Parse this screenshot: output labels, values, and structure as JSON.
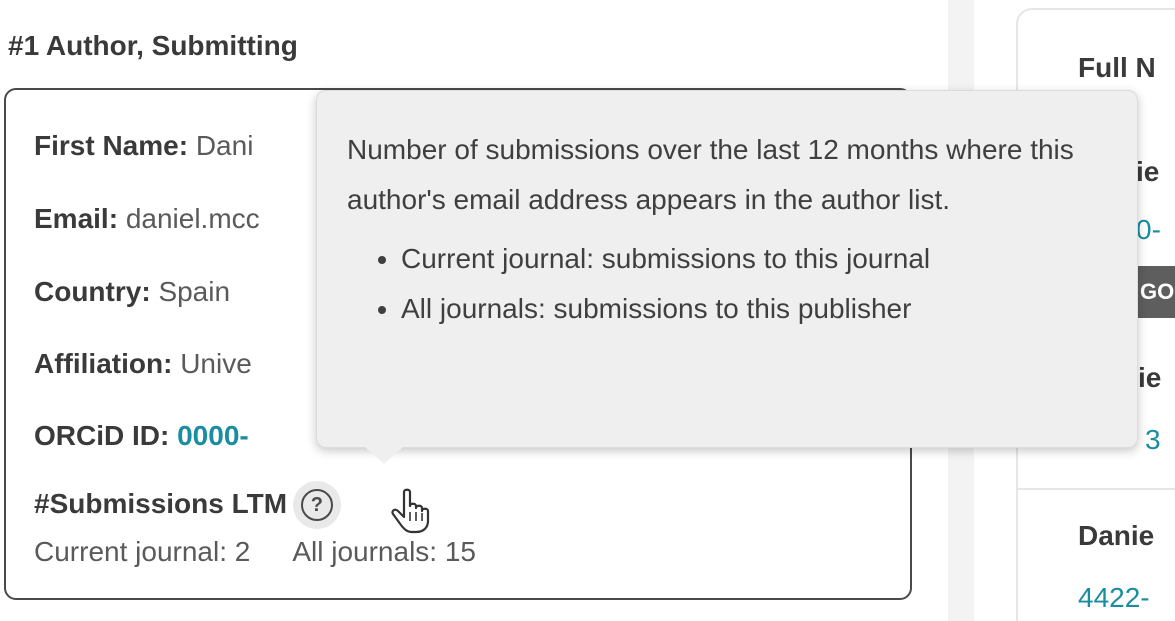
{
  "section": {
    "title": "#1 Author, Submitting"
  },
  "author": {
    "first_name_label": "First Name:",
    "first_name_value": "Dani",
    "email_label": "Email:",
    "email_value": "daniel.mcc",
    "country_label": "Country:",
    "country_value": "Spain",
    "affiliation_label": "Affiliation:",
    "affiliation_value": "Unive",
    "orcid_label": "ORCiD ID:",
    "orcid_value": "0000-",
    "submissions_label": "#Submissions LTM",
    "help_icon": "question-circle-icon",
    "current_journal": "Current journal: 2",
    "all_journals": "All journals: 15"
  },
  "tooltip": {
    "body": "Number of submissions over the last 12 months where this author's email address appears in the author list.",
    "items": [
      "Current journal: submissions to this journal",
      "All journals: submissions to this publisher"
    ]
  },
  "right_panel": {
    "header_fragment": "Full N",
    "name_fragment_1": "ie",
    "link_fragment_1": "0-",
    "chip_fragment": "GO",
    "name_fragment_2": "ie",
    "link_fragment_2": "3",
    "name_fragment_3": "Danie",
    "link_fragment_3": "4422-"
  },
  "colors": {
    "accent_link": "#1a8ea0",
    "tooltip_bg": "#efefef",
    "card_border": "#4a4a4a"
  }
}
